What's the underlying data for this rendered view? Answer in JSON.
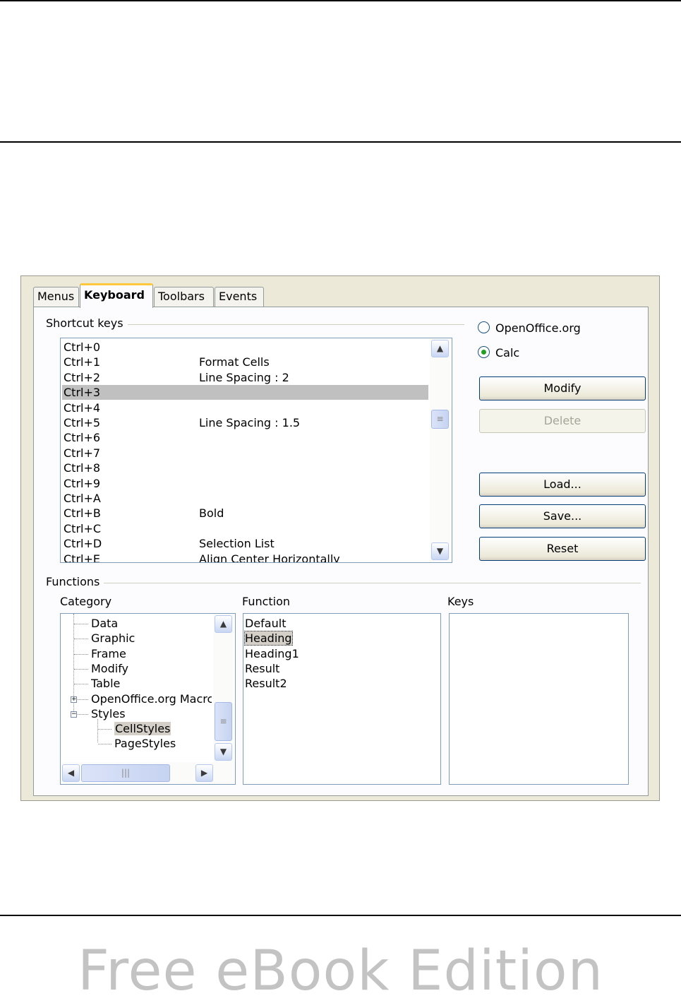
{
  "tabs": [
    "Menus",
    "Keyboard",
    "Toolbars",
    "Events"
  ],
  "shortcut_keys": {
    "label": "Shortcut keys",
    "rows": [
      {
        "key": "Ctrl+0",
        "func": ""
      },
      {
        "key": "Ctrl+1",
        "func": "Format Cells"
      },
      {
        "key": "Ctrl+2",
        "func": "Line Spacing : 2"
      },
      {
        "key": "Ctrl+3",
        "func": ""
      },
      {
        "key": "Ctrl+4",
        "func": ""
      },
      {
        "key": "Ctrl+5",
        "func": "Line Spacing : 1.5"
      },
      {
        "key": "Ctrl+6",
        "func": ""
      },
      {
        "key": "Ctrl+7",
        "func": ""
      },
      {
        "key": "Ctrl+8",
        "func": ""
      },
      {
        "key": "Ctrl+9",
        "func": ""
      },
      {
        "key": "Ctrl+A",
        "func": ""
      },
      {
        "key": "Ctrl+B",
        "func": "Bold"
      },
      {
        "key": "Ctrl+C",
        "func": ""
      },
      {
        "key": "Ctrl+D",
        "func": "Selection List"
      },
      {
        "key": "Ctrl+E",
        "func": "Align Center Horizontally"
      }
    ],
    "selected": "Ctrl+3"
  },
  "scope": {
    "openoffice": "OpenOffice.org",
    "calc": "Calc",
    "selected": "Calc"
  },
  "buttons": {
    "modify": "Modify",
    "delete": "Delete",
    "load": "Load...",
    "save": "Save...",
    "reset": "Reset"
  },
  "functions": {
    "label": "Functions",
    "category_label": "Category",
    "function_label": "Function",
    "keys_label": "Keys",
    "categories": [
      {
        "label": "Data"
      },
      {
        "label": "Graphic"
      },
      {
        "label": "Frame"
      },
      {
        "label": "Modify"
      },
      {
        "label": "Table"
      },
      {
        "label": "OpenOffice.org Macrc"
      },
      {
        "label": "Styles"
      },
      {
        "label": "CellStyles"
      },
      {
        "label": "PageStyles"
      }
    ],
    "selected_category": "CellStyles",
    "function_items": [
      "Default",
      "Heading",
      "Heading1",
      "Result",
      "Result2"
    ],
    "selected_function": "Heading"
  },
  "footer": "Free eBook Edition"
}
